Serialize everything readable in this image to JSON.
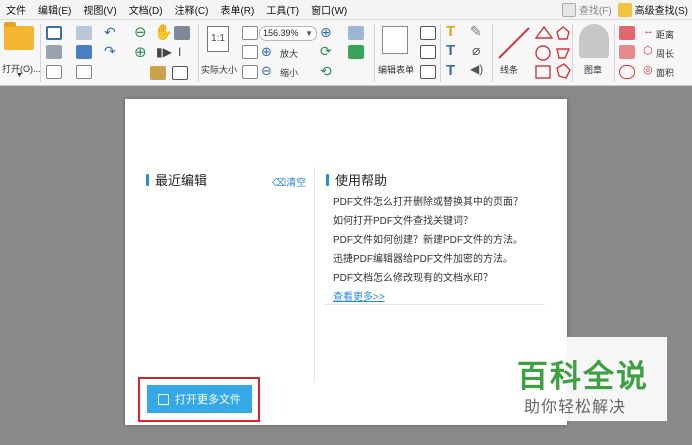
{
  "menubar": {
    "items": [
      "文件",
      "编辑(E)",
      "视图(V)",
      "文档(D)",
      "注释(C)",
      "表单(R)",
      "工具(T)",
      "窗口(W)"
    ],
    "search": "查找(F)",
    "advanced_search": "高级查找(S)"
  },
  "toolbar": {
    "open_label": "打开(O)...",
    "zoom_value": "156.39%",
    "zoom_in_label": "放大",
    "zoom_out_label": "缩小",
    "actual_size_label": "实际大小",
    "edit_form_label": "编辑表单",
    "lines_label": "线条",
    "stamp_label": "图章",
    "distance_label": "距离",
    "perimeter_label": "周长",
    "area_label": "面积"
  },
  "start_panel": {
    "recent_title": "最近编辑",
    "clear_label": "清空",
    "help_title": "使用帮助",
    "help_items": [
      "PDF文件怎么打开删除或替换其中的页面？",
      "如何打开PDF文件查找关键词？",
      "PDF文件如何创建？新建PDF文件的方法。",
      "迅捷PDF编辑器给PDF文件加密的方法。",
      "PDF文档怎么修改现有的文档水印？"
    ],
    "more_label": "查看更多>>",
    "open_more_label": "打开更多文件"
  },
  "watermark": {
    "title": "百科全说",
    "subtitle": "助你轻松解决"
  },
  "colors": {
    "accent": "#35a9e8",
    "highlight_border": "#d8232a",
    "watermark_green": "#3ea042"
  }
}
